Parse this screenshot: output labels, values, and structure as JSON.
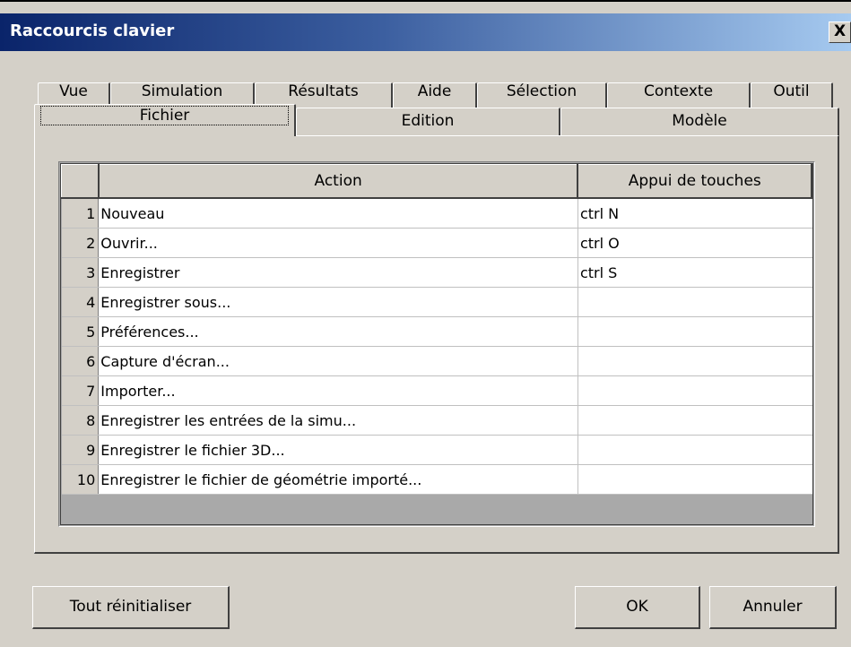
{
  "window": {
    "title": "Raccourcis clavier",
    "close_label": "X"
  },
  "tabs_back": [
    "Vue",
    "Simulation",
    "Résultats",
    "Aide",
    "Sélection",
    "Contexte",
    "Outil"
  ],
  "tabs_front": [
    "Fichier",
    "Edition",
    "Modèle"
  ],
  "active_tab": "Fichier",
  "table": {
    "headers": {
      "action": "Action",
      "keys": "Appui de touches"
    },
    "rows": [
      {
        "num": "1",
        "action": "Nouveau",
        "keys": "ctrl N"
      },
      {
        "num": "2",
        "action": "Ouvrir...",
        "keys": "ctrl O"
      },
      {
        "num": "3",
        "action": "Enregistrer",
        "keys": "ctrl S"
      },
      {
        "num": "4",
        "action": "Enregistrer sous...",
        "keys": ""
      },
      {
        "num": "5",
        "action": "Préférences...",
        "keys": ""
      },
      {
        "num": "6",
        "action": "Capture d'écran...",
        "keys": ""
      },
      {
        "num": "7",
        "action": "Importer...",
        "keys": ""
      },
      {
        "num": "8",
        "action": "Enregistrer les entrées de la simu...",
        "keys": ""
      },
      {
        "num": "9",
        "action": "Enregistrer le fichier 3D...",
        "keys": ""
      },
      {
        "num": "10",
        "action": "Enregistrer le fichier de géométrie importé...",
        "keys": ""
      }
    ]
  },
  "buttons": {
    "reset": "Tout réinitialiser",
    "ok": "OK",
    "cancel": "Annuler"
  },
  "colors": {
    "title_start": "#0a246a",
    "title_end": "#a6caf0",
    "face": "#d4d0c8"
  }
}
